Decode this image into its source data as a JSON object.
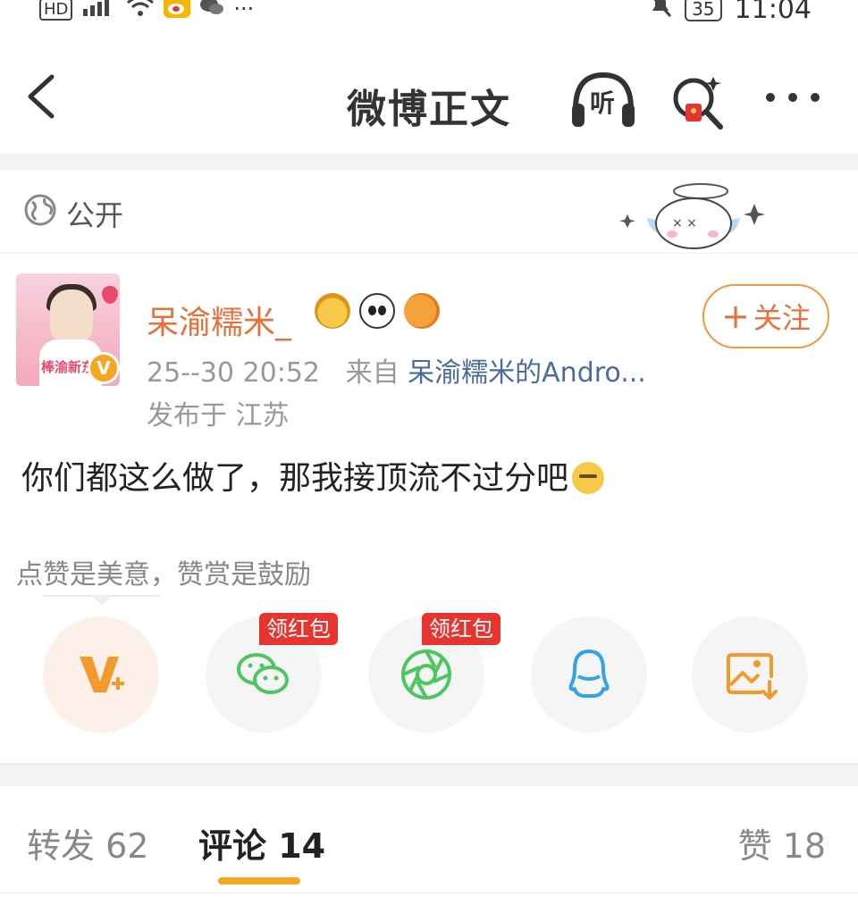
{
  "status_bar": {
    "left_label": "HD",
    "right_battery": "35",
    "time": "11:04"
  },
  "nav": {
    "title": "微博正文",
    "listen_label": "听"
  },
  "visibility": {
    "label": "公开"
  },
  "post": {
    "username": "呆渝糯米_",
    "avatar_text": "棒渝新东",
    "verified_mark": "V",
    "follow_label": "关注",
    "follow_plus": "+",
    "date": "25-",
    "time_partial": "-30 20:52",
    "from_label": "来自",
    "source": "呆渝糯米的Andro...",
    "location": "发布于 江苏",
    "text": "你们都这么做了，那我接顶流不过分吧"
  },
  "reward": {
    "note": "点赞是美意，赞赏是鼓励"
  },
  "share": {
    "items": [
      {
        "name": "vplus"
      },
      {
        "name": "wechat",
        "badge": "领红包"
      },
      {
        "name": "moments",
        "badge": "领红包"
      },
      {
        "name": "qq"
      },
      {
        "name": "save-image"
      }
    ]
  },
  "tabs": {
    "repost": "转发 62",
    "comment": "评论 14",
    "like": "赞 18"
  },
  "colors": {
    "accent": "#f5a623",
    "username": "#e8703a",
    "link": "#4a6b9d",
    "wechat_green": "#4cc65e",
    "qq_blue": "#35a2e6",
    "redpack": "#e8342f"
  }
}
